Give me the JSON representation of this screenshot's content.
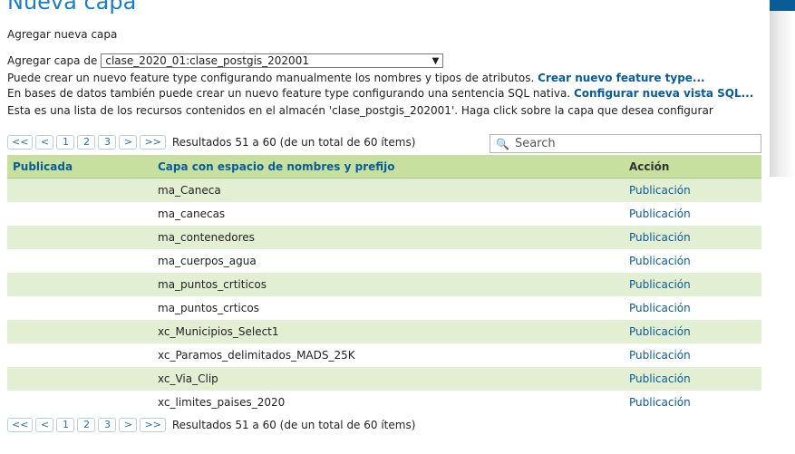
{
  "page": {
    "title": "Nueva capa",
    "subtitle": "Agregar nueva capa"
  },
  "store": {
    "label": "Agregar capa de",
    "selected": "clase_2020_01:clase_postgis_202001"
  },
  "info": {
    "line1_text": "Puede crear un nuevo feature type configurando manualmente los nombres y tipos de atributos.",
    "line1_link": "Crear nuevo feature type...",
    "line2_text": "En bases de datos también puede crear un nuevo feature type configurando una sentencia SQL nativa.",
    "line2_link": "Configurar nueva vista SQL...",
    "line3_text": "Esta es una lista de los recursos contenidos en el almacén 'clase_postgis_202001'. Haga click sobre la capa que desea configurar"
  },
  "pager": {
    "first": "<<",
    "prev": "<",
    "pages": [
      "1",
      "2",
      "3"
    ],
    "next": ">",
    "last": ">>",
    "results": "Resultados 51 a 60 (de un total de 60 ítems)"
  },
  "search": {
    "placeholder": "Search",
    "icon": "search-icon"
  },
  "table": {
    "headers": [
      "Publicada",
      "Capa con espacio de nombres y prefijo",
      "Acción"
    ],
    "rows": [
      {
        "published": "",
        "name": "ma_Caneca",
        "action": "Publicación"
      },
      {
        "published": "",
        "name": "ma_canecas",
        "action": "Publicación"
      },
      {
        "published": "",
        "name": "ma_contenedores",
        "action": "Publicación"
      },
      {
        "published": "",
        "name": "ma_cuerpos_agua",
        "action": "Publicación"
      },
      {
        "published": "",
        "name": "ma_puntos_crtiticos",
        "action": "Publicación"
      },
      {
        "published": "",
        "name": "ma_puntos_crticos",
        "action": "Publicación"
      },
      {
        "published": "",
        "name": "xc_Municipios_Select1",
        "action": "Publicación"
      },
      {
        "published": "",
        "name": "xc_Paramos_delimitados_MADS_25K",
        "action": "Publicación"
      },
      {
        "published": "",
        "name": "xc_Via_Clip",
        "action": "Publicación"
      },
      {
        "published": "",
        "name": "xc_limites_paises_2020",
        "action": "Publicación"
      }
    ]
  },
  "colors": {
    "accent": "#1a7fc1",
    "link": "#0a5c99",
    "header_bg": "#c7e0a0",
    "row_alt": "#e3efd2"
  }
}
